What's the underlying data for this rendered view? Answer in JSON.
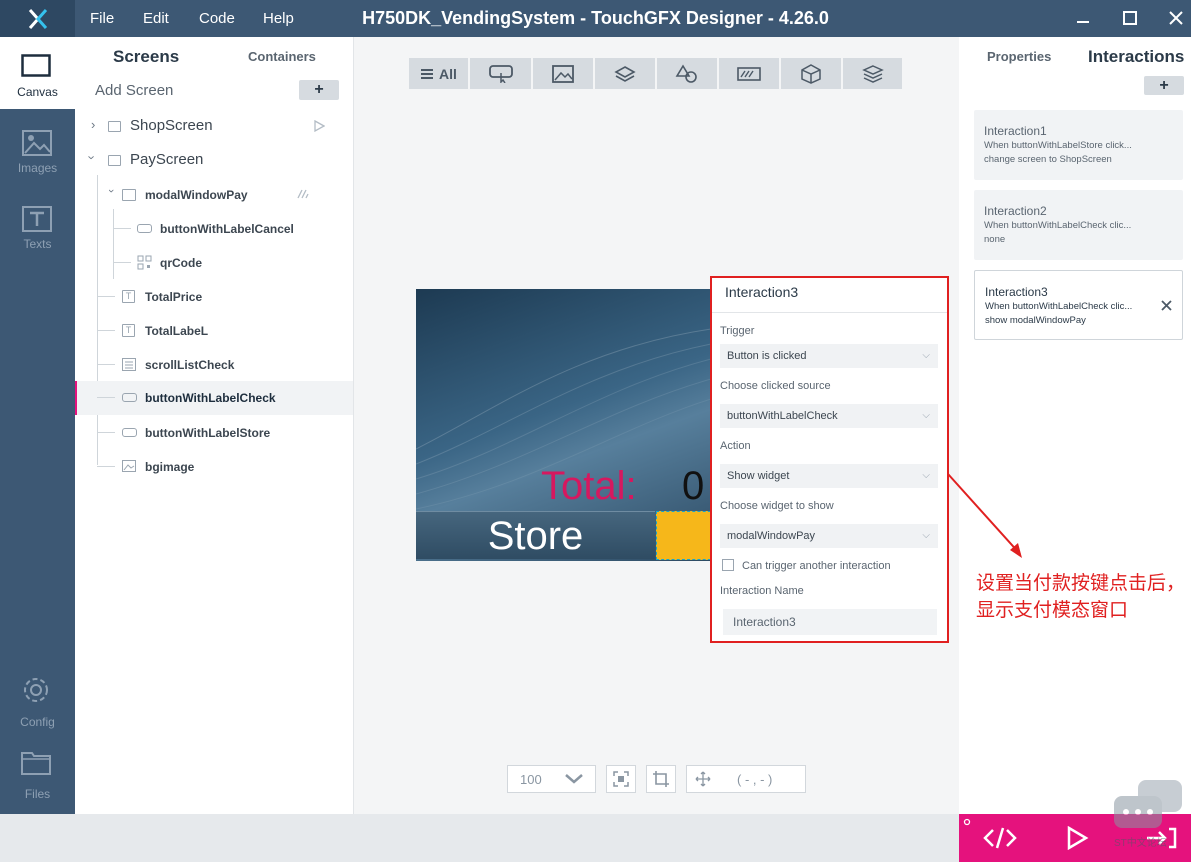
{
  "app": {
    "title": "H750DK_VendingSystem - TouchGFX Designer - 4.26.0",
    "menu": [
      "File",
      "Edit",
      "Code",
      "Help"
    ]
  },
  "nav": {
    "items": [
      {
        "label": "Canvas",
        "icon": "canvas-icon"
      },
      {
        "label": "Images",
        "icon": "image-icon"
      },
      {
        "label": "Texts",
        "icon": "text-icon"
      },
      {
        "label": "Config",
        "icon": "gear-icon"
      },
      {
        "label": "Files",
        "icon": "folder-icon"
      }
    ]
  },
  "screens_panel": {
    "tabs": [
      "Screens",
      "Containers"
    ],
    "add_screen": "Add Screen",
    "add_button": "+",
    "tree": [
      {
        "label": "ShopScreen",
        "level": 0,
        "icon": "screen-icon"
      },
      {
        "label": "PayScreen",
        "level": 0,
        "icon": "screen-icon"
      },
      {
        "label": "modalWindowPay",
        "level": 1,
        "icon": "modal-window-icon"
      },
      {
        "label": "buttonWithLabelCancel",
        "level": 2,
        "icon": "button-icon"
      },
      {
        "label": "qrCode",
        "level": 2,
        "icon": "qr-icon"
      },
      {
        "label": "TotalPrice",
        "level": 1,
        "icon": "textarea-icon"
      },
      {
        "label": "TotalLabeL",
        "level": 1,
        "icon": "textarea-icon"
      },
      {
        "label": "scrollListCheck",
        "level": 1,
        "icon": "list-icon"
      },
      {
        "label": "buttonWithLabelCheck",
        "level": 1,
        "icon": "button-icon",
        "selected": true
      },
      {
        "label": "buttonWithLabelStore",
        "level": 1,
        "icon": "button-icon"
      },
      {
        "label": "bgimage",
        "level": 1,
        "icon": "image-icon"
      }
    ]
  },
  "toolbar": {
    "all_label": "All"
  },
  "device": {
    "total_label": "Total:",
    "total_value": "0",
    "store_button": "Store"
  },
  "popup": {
    "title": "Interaction3",
    "trigger_label": "Trigger",
    "trigger_value": "Button is clicked",
    "source_label": "Choose clicked source",
    "source_value": "buttonWithLabelCheck",
    "action_label": "Action",
    "action_value": "Show widget",
    "widget_label": "Choose widget to show",
    "widget_value": "modalWindowPay",
    "chain_label": "Can trigger another interaction",
    "name_label": "Interaction Name",
    "name_value": "Interaction3"
  },
  "right_panel": {
    "tabs": [
      "Properties",
      "Interactions"
    ],
    "add_button": "+",
    "interactions": [
      {
        "name": "Interaction1",
        "line1": "When buttonWithLabelStore click...",
        "line2": "change screen to ShopScreen"
      },
      {
        "name": "Interaction2",
        "line1": "When buttonWithLabelCheck clic...",
        "line2": "none"
      },
      {
        "name": "Interaction3",
        "line1": "When buttonWithLabelCheck clic...",
        "line2": "show modalWindowPay"
      }
    ]
  },
  "zoom": {
    "value": "100",
    "coords": "( - , - )"
  },
  "annotation": "设置当付款按键点击后，显示支付模态窗口",
  "watermark": "ST中文论坛",
  "colors": {
    "titlebar": "#3d5874",
    "accent": "#e5127d",
    "highlight": "#e02020",
    "total_text": "#d6185f",
    "check_button": "#f6b71a"
  }
}
